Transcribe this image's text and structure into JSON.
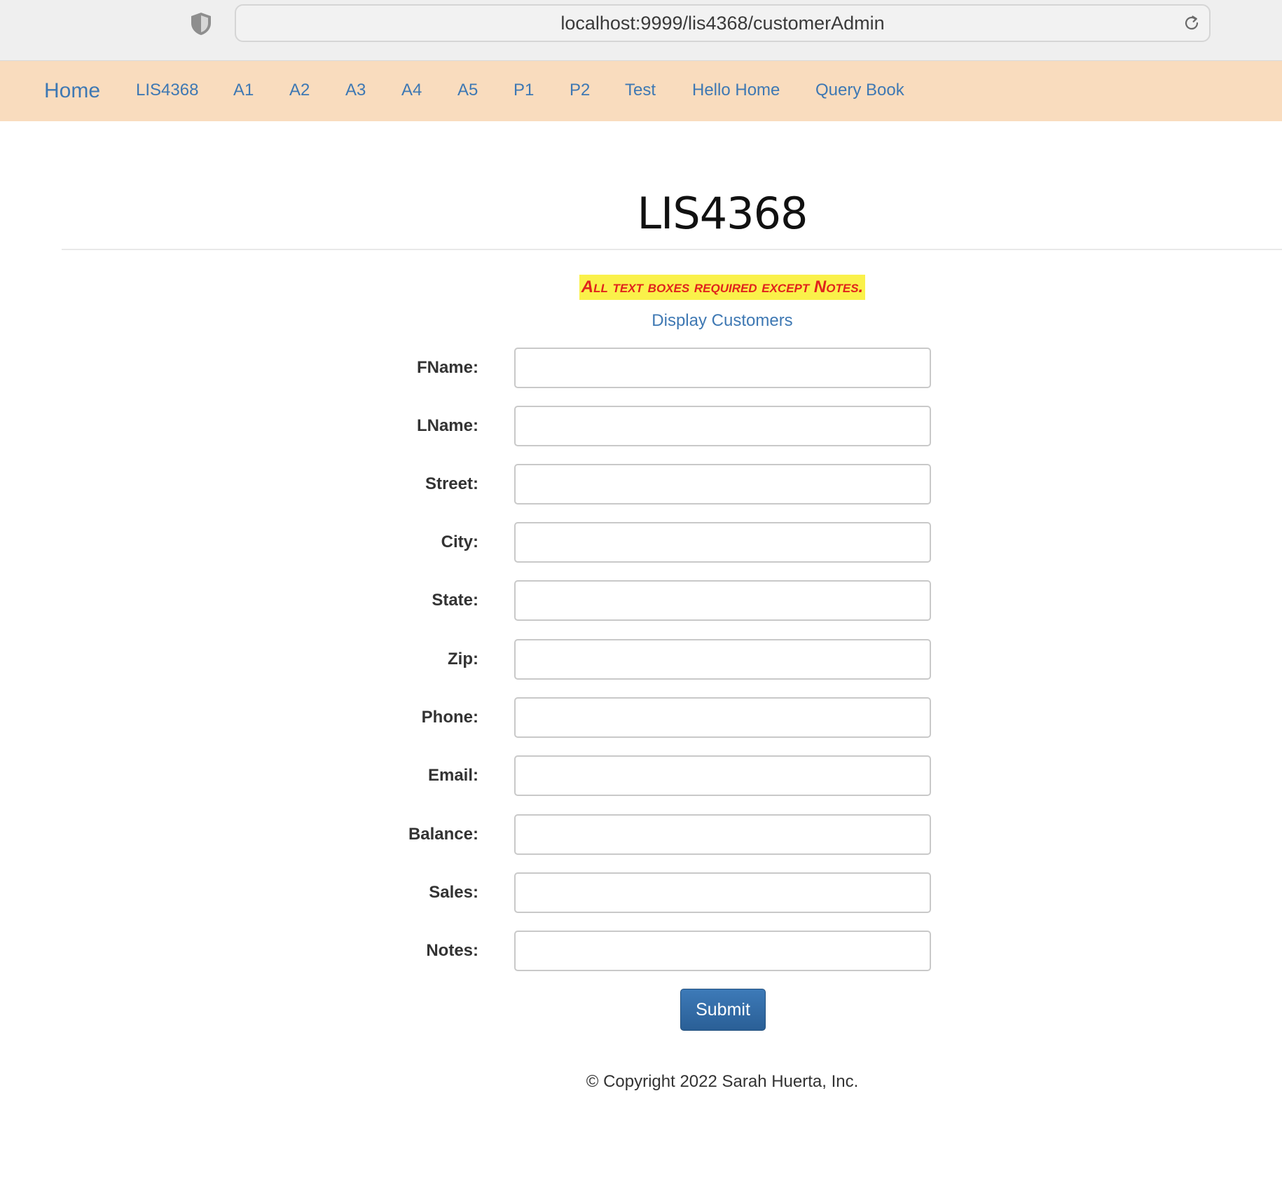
{
  "browser": {
    "url": "localhost:9999/lis4368/customerAdmin",
    "shield_icon": "shield-icon",
    "reload_icon": "reload-icon"
  },
  "navbar": {
    "brand": "Home",
    "links": [
      "LIS4368",
      "A1",
      "A2",
      "A3",
      "A4",
      "A5",
      "P1",
      "P2",
      "Test",
      "Hello Home",
      "Query Book"
    ],
    "background_color": "#f9dcbe",
    "link_color": "#3e78b3"
  },
  "main": {
    "title": "LIS4368",
    "notice": "All text boxes required except Notes.",
    "display_link": "Display Customers"
  },
  "form": {
    "fields": [
      {
        "label": "FName:",
        "value": ""
      },
      {
        "label": "LName:",
        "value": ""
      },
      {
        "label": "Street:",
        "value": ""
      },
      {
        "label": "City:",
        "value": ""
      },
      {
        "label": "State:",
        "value": ""
      },
      {
        "label": "Zip:",
        "value": ""
      },
      {
        "label": "Phone:",
        "value": ""
      },
      {
        "label": "Email:",
        "value": ""
      },
      {
        "label": "Balance:",
        "value": ""
      },
      {
        "label": "Sales:",
        "value": ""
      },
      {
        "label": "Notes:",
        "value": ""
      }
    ],
    "submit_label": "Submit"
  },
  "footer": {
    "copyright": "© Copyright 2022 Sarah Huerta, Inc."
  }
}
